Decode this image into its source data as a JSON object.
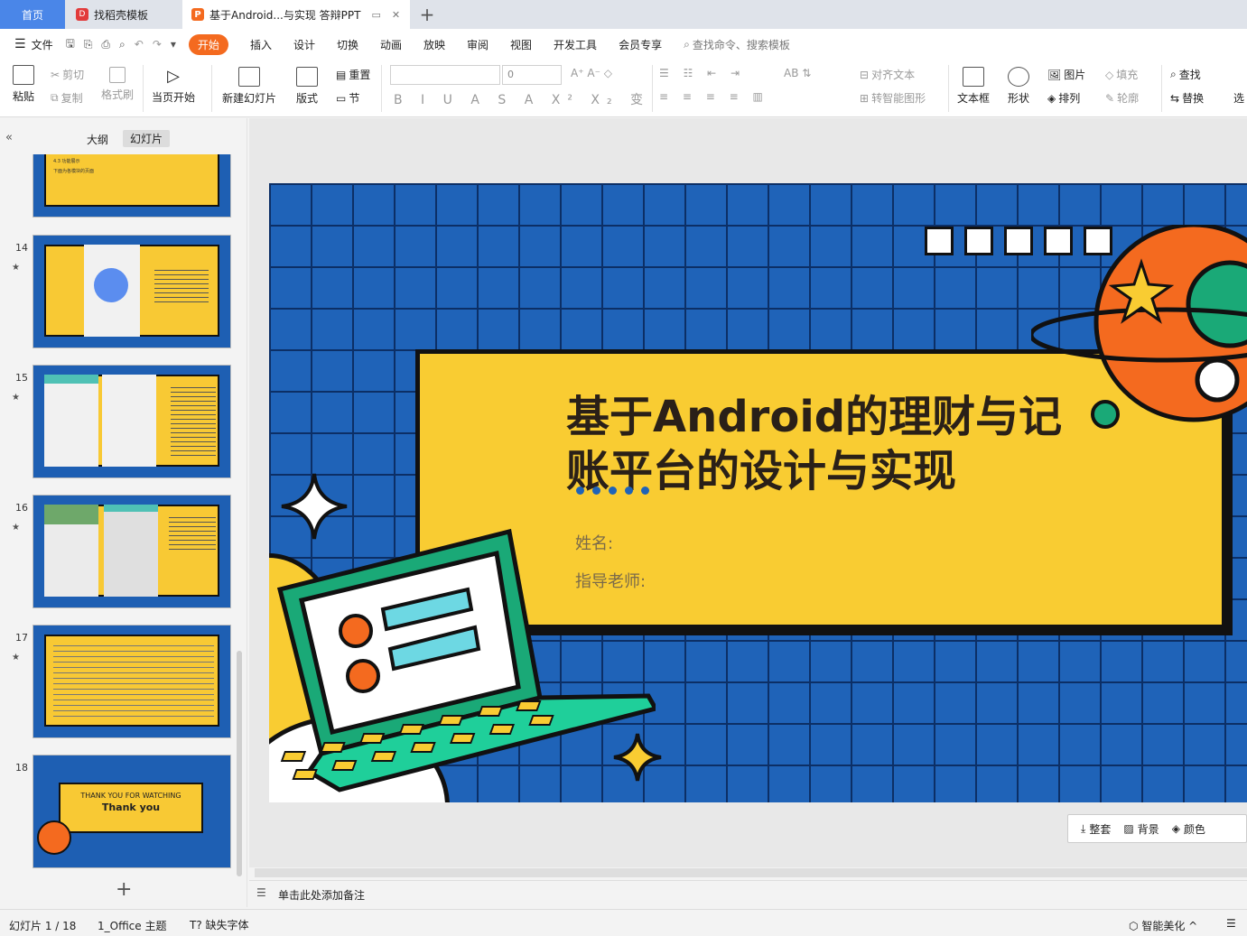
{
  "tabs": {
    "home": "首页",
    "template": "找稻壳模板",
    "document": "基于Android...与实现 答辩PPT"
  },
  "menu": {
    "file": "文件",
    "items": [
      "开始",
      "插入",
      "设计",
      "切换",
      "动画",
      "放映",
      "审阅",
      "视图",
      "开发工具",
      "会员专享"
    ],
    "search_placeholder": "查找命令、搜索模板"
  },
  "ribbon": {
    "paste": "粘贴",
    "cut": "剪切",
    "copy": "复制",
    "format_painter": "格式刷",
    "from_current": "当页开始",
    "new_slide": "新建幻灯片",
    "layout": "版式",
    "reset": "重置",
    "section": "节",
    "font_size": "0",
    "align_text": "对齐文本",
    "smartart": "转智能图形",
    "textbox": "文本框",
    "shape": "形状",
    "picture": "图片",
    "arrange": "排列",
    "fill": "填充",
    "outline": "轮廓",
    "find": "查找",
    "replace": "替换",
    "select": "选"
  },
  "left_panel": {
    "outline_tab": "大纲",
    "slides_tab": "幻灯片",
    "thumbnails": [
      {
        "num": "14"
      },
      {
        "num": "15"
      },
      {
        "num": "16"
      },
      {
        "num": "17"
      },
      {
        "num": "18"
      }
    ],
    "partial_text_1": "4.3 功能展示",
    "partial_text_2": "下面为各模块的页面",
    "thumb18_line1": "THANK YOU FOR WATCHING",
    "thumb18_line2": "Thank you",
    "add_slide": "+"
  },
  "slide": {
    "title_line1": "基于Android的理财与记",
    "title_line2": "账平台的设计与实现",
    "name_label": "姓名:",
    "advisor_label": "指导老师:"
  },
  "quickbar": {
    "whole": "整套",
    "background": "背景",
    "color": "颜色"
  },
  "notes": {
    "placeholder": "单击此处添加备注"
  },
  "status": {
    "slide_count": "幻灯片 1 / 18",
    "theme": "1_Office 主题",
    "missing_font": "缺失字体",
    "beautify": "智能美化"
  },
  "colors": {
    "accent": "#f46a1f",
    "slide_blue": "#1f63b8",
    "slide_yellow": "#f9cc32",
    "laptop_green": "#1aa977"
  }
}
